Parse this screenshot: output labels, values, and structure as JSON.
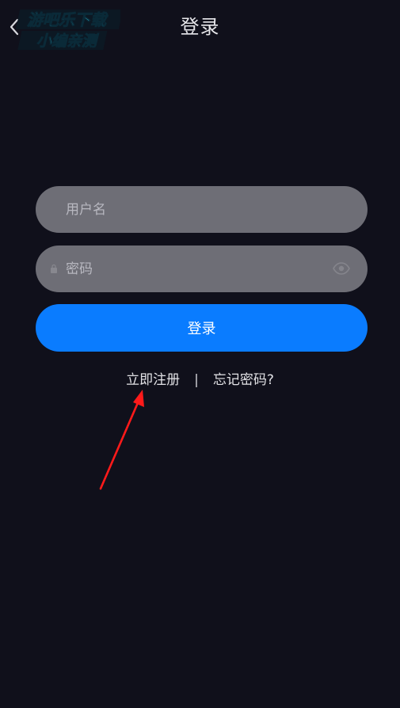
{
  "header": {
    "title": "登录",
    "back_icon": "chevron-left-icon"
  },
  "watermark": {
    "line1": "游吧乐下载",
    "line2": "小编亲测",
    "color": "#3fe0ff"
  },
  "form": {
    "username_placeholder": "用户名",
    "password_placeholder": "密码",
    "password_toggle_icon": "eye-icon",
    "login_label": "登录"
  },
  "links": {
    "register": "立即注册",
    "divider": "|",
    "forgot": "忘记密码?"
  },
  "colors": {
    "background": "#10101b",
    "field": "#6e6e76",
    "accent": "#0a7cff",
    "annotation": "#ff1a1a"
  }
}
